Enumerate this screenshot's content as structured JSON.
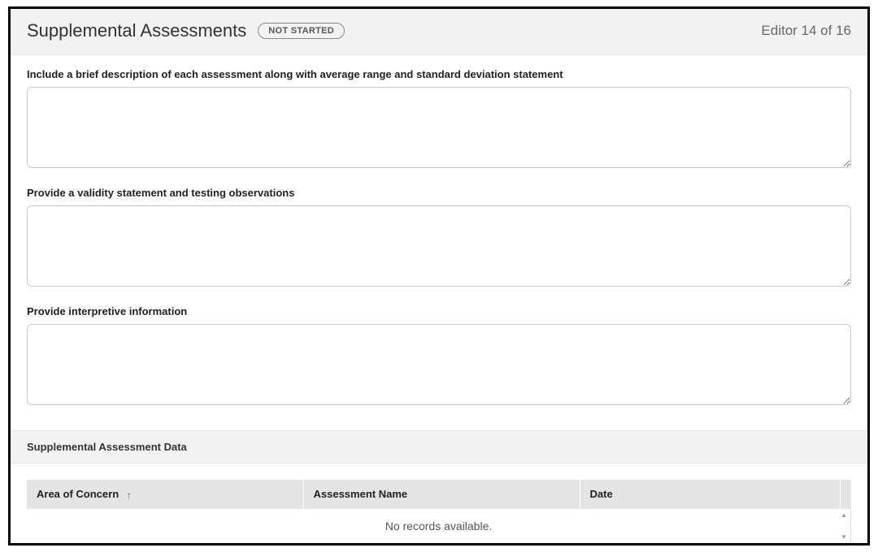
{
  "header": {
    "title": "Supplemental Assessments",
    "status": "NOT STARTED",
    "editor_label": "Editor 14 of 16"
  },
  "form": {
    "description": {
      "label": "Include a brief description of each assessment along with average range and standard deviation statement",
      "value": ""
    },
    "validity": {
      "label": "Provide a validity statement and testing observations",
      "value": ""
    },
    "interpretive": {
      "label": "Provide interpretive information",
      "value": ""
    }
  },
  "section": {
    "title": "Supplemental Assessment Data"
  },
  "table": {
    "columns": {
      "area": "Area of Concern",
      "name": "Assessment Name",
      "date": "Date"
    },
    "sort_icon": "↑",
    "empty": "No records available."
  }
}
